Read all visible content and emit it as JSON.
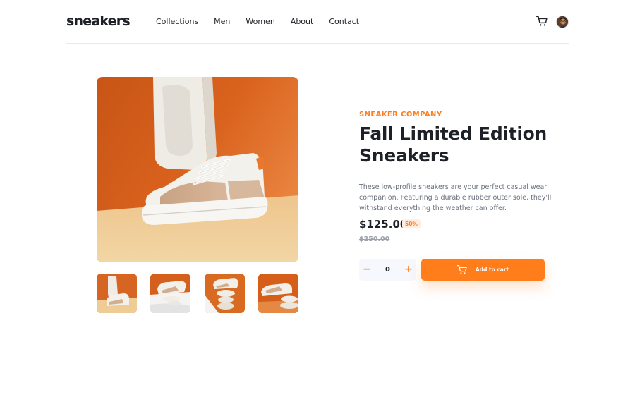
{
  "header": {
    "logo": "sneakers",
    "nav": [
      "Collections",
      "Men",
      "Women",
      "About",
      "Contact"
    ],
    "cart_icon": "cart-icon",
    "avatar_icon": "user-avatar"
  },
  "gallery": {
    "main_image": "white-tan-sneakers-orange-backdrop",
    "thumbnails": [
      "sneakers-thumb-1",
      "sneakers-thumb-2",
      "sneakers-thumb-3",
      "sneakers-thumb-4"
    ]
  },
  "product": {
    "company": "SNEAKER COMPANY",
    "title": "Fall Limited Edition Sneakers",
    "description": "These low-profile sneakers are your perfect casual wear companion. Featuring a durable rubber outer sole, they'll withstand everything the weather can offer.",
    "price": "$125.00",
    "discount": "50%",
    "original_price": "$250.00"
  },
  "cart_controls": {
    "minus": "−",
    "quantity": "0",
    "plus": "+",
    "add_label": "Add to cart"
  },
  "colors": {
    "accent": "#ff7e1b",
    "accent_pale": "#ffede0",
    "text_dark": "#1d2026",
    "text_grey": "#69707d",
    "light_bg": "#f6f8fd"
  }
}
